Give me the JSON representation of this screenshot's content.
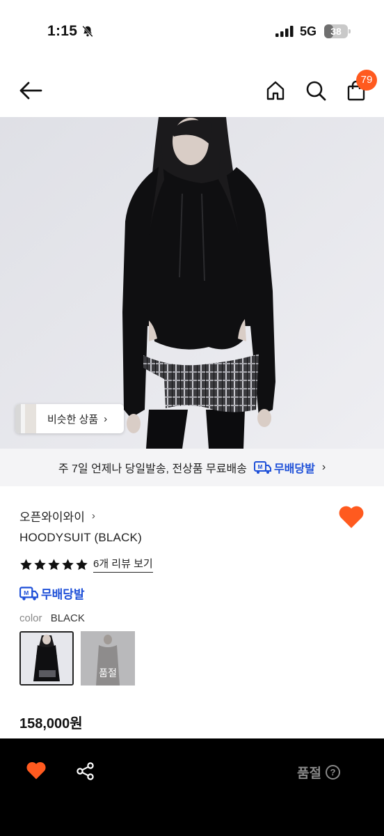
{
  "status_bar": {
    "time": "1:15",
    "network": "5G",
    "battery": "38",
    "battery_level": 0.38,
    "icons": [
      "bell-off-icon",
      "signal-icon",
      "battery-icon"
    ]
  },
  "nav": {
    "cart_count": "79",
    "icons": [
      "back-arrow-icon",
      "home-icon",
      "search-icon",
      "cart-icon"
    ]
  },
  "hero": {
    "similar_label": "비슷한 상품",
    "similar_chevron": "›"
  },
  "shipping_banner": {
    "text": "주 7일 언제나 당일발송, 전상품 무료배송",
    "logo_label": "무배당발",
    "chevron": "›"
  },
  "product": {
    "brand": "오픈와이와이",
    "brand_chevron": "›",
    "name": "HOODYSUIT (BLACK)",
    "rating_stars": 5,
    "review_link": "6개 리뷰 보기",
    "free_ship_label": "무배당발",
    "color_key": "color",
    "color_value": "BLACK",
    "swatches": [
      {
        "selected": true,
        "sold_out_label": ""
      },
      {
        "selected": false,
        "sold_out_label": "품절"
      }
    ],
    "price": "158,000원"
  },
  "bottom_bar": {
    "status": "품절",
    "help": "?",
    "icons": [
      "heart-icon",
      "share-icon",
      "help-icon"
    ]
  },
  "colors": {
    "accent_orange": "#ff5a1f",
    "ship_blue": "#1d4fd8",
    "bottom_bar": "#000000",
    "disabled_text": "#8a8a8a"
  }
}
